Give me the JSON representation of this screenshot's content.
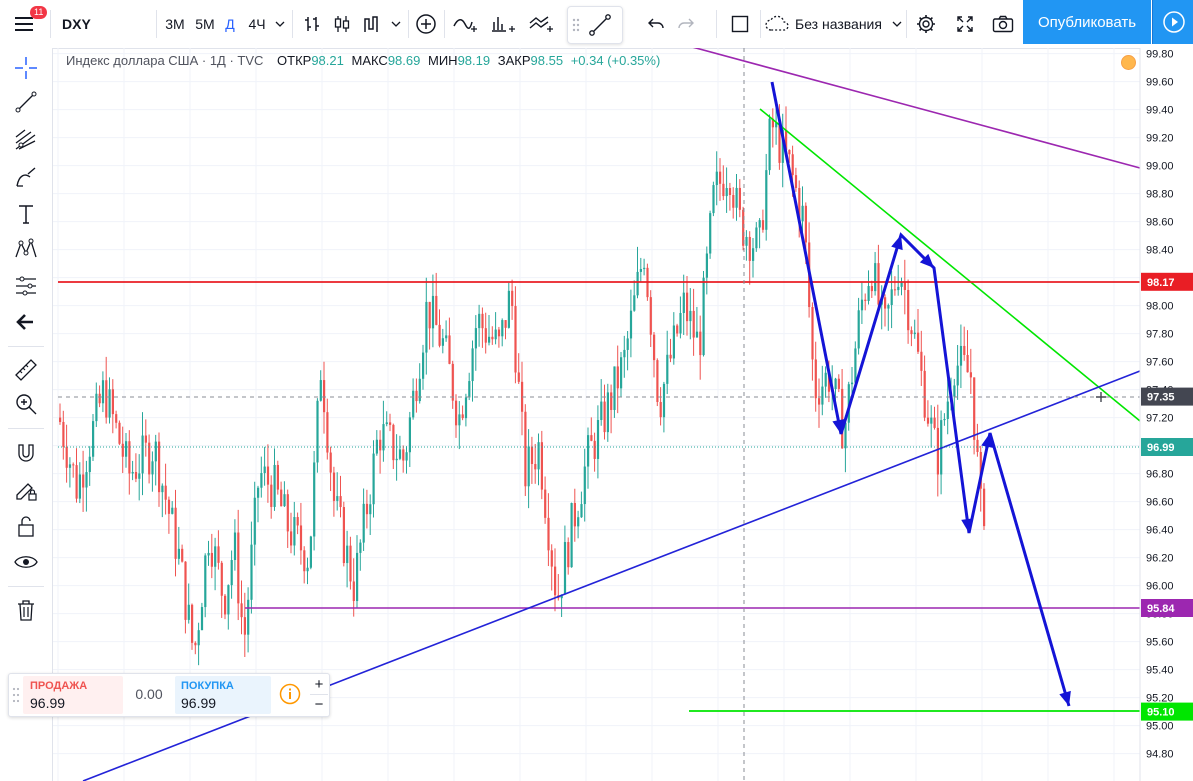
{
  "toolbar": {
    "menu_badge": "11",
    "symbol": "DXY",
    "intervals": [
      "3М",
      "5М",
      "Д",
      "4Ч"
    ],
    "active_interval": "Д",
    "layout_name": "Без названия",
    "publish_label": "Опубликовать"
  },
  "legend": {
    "title": "Индекс доллара США · 1Д · TVC",
    "open_label": "ОТКР",
    "open_value": "98.21",
    "high_label": "МАКС",
    "high_value": "98.69",
    "low_label": "МИН",
    "low_value": "98.19",
    "close_label": "ЗАКР",
    "close_value": "98.55",
    "change": "+0.34 (+0.35%)"
  },
  "order_panel": {
    "sell_label": "ПРОДАЖА",
    "sell_price": "96.99",
    "spread": "0.00",
    "buy_label": "ПОКУПКА",
    "buy_price": "96.99",
    "plus": "+",
    "minus": "−"
  },
  "price_axis": {
    "ticks": [
      "99.80",
      "99.60",
      "99.40",
      "99.20",
      "99.00",
      "98.80",
      "98.60",
      "98.40",
      "98.20",
      "98.00",
      "97.80",
      "97.60",
      "97.40",
      "97.20",
      "97.00",
      "96.80",
      "96.60",
      "96.40",
      "96.20",
      "96.00",
      "95.80",
      "95.60",
      "95.40",
      "95.20",
      "95.00",
      "94.80"
    ],
    "labels": [
      {
        "text": "98.17",
        "value": 98.17,
        "color": "#e91e25"
      },
      {
        "text": "97.35",
        "value": 97.35,
        "color": "#434651"
      },
      {
        "text": "96.99",
        "value": 96.99,
        "color": "#26a69a"
      },
      {
        "text": "95.84",
        "value": 95.84,
        "color": "#9c27b0"
      },
      {
        "text": "95.10",
        "value": 95.1,
        "color": "#00e600"
      }
    ]
  },
  "colors": {
    "up": "#26a69a",
    "down": "#ef5350",
    "accent": "#2962ff",
    "publish": "#2196f3"
  },
  "icons": [
    "menu-icon",
    "bar-chart-icon",
    "candles-icon",
    "line-chart-icon",
    "indicators-icon",
    "compare-icon",
    "templates-icon",
    "trend-line-icon",
    "undo-icon",
    "redo-icon",
    "cloud-icon",
    "settings-icon",
    "fullscreen-icon",
    "camera-icon",
    "play-icon",
    "crosshair-icon",
    "trendline-tool-icon",
    "fib-icon",
    "brush-icon",
    "text-icon",
    "pattern-icon",
    "measure-icon",
    "ruler-icon",
    "zoom-icon",
    "magnet-icon",
    "lock-draw-icon",
    "lock-icon",
    "eye-icon",
    "trash-icon",
    "info-icon"
  ]
}
